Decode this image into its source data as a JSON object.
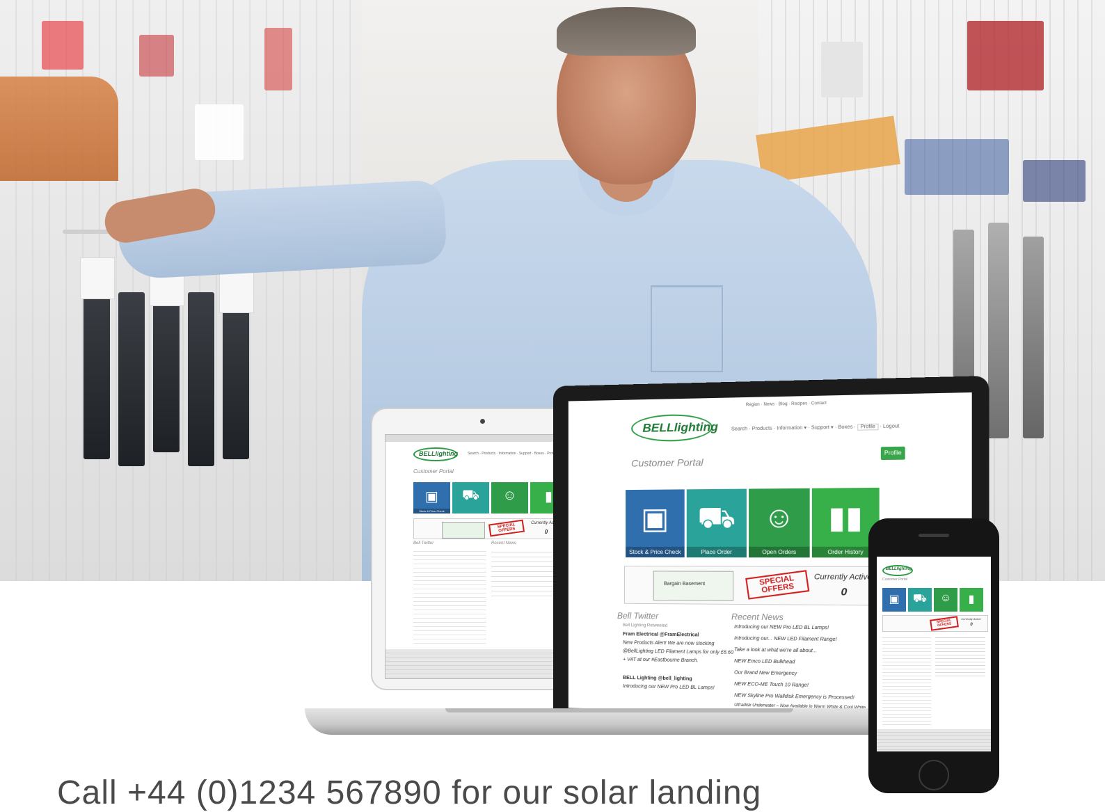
{
  "brand": {
    "logo": "BELLlighting",
    "accent": "#3aa64b"
  },
  "laptop": {
    "top_nav": [
      "Region",
      "News",
      "Blog",
      "Recipes",
      "Contact"
    ],
    "nav": [
      "Search",
      "Products",
      "Information",
      "Support",
      "Boxes",
      "Profile",
      "Logout"
    ],
    "portal_title": "Customer Portal",
    "profile_button": "Profile",
    "tiles": [
      {
        "label": "Stock & Price Check",
        "color": "#2f6fae",
        "icon": "monitor-icon"
      },
      {
        "label": "Place Order",
        "color": "#2aa39a",
        "icon": "cart-icon"
      },
      {
        "label": "Open Orders",
        "color": "#2f9c4a",
        "icon": "reader-icon"
      },
      {
        "label": "Order History",
        "color": "#38b04a",
        "icon": "books-icon"
      }
    ],
    "bargain_label": "Bargain Basement",
    "offer_stamp": "SPECIAL OFFERS",
    "active_label": "Currently Active:",
    "active_count": "0",
    "twitter_title": "Bell Twitter",
    "tweets": [
      "Bell Lighting Retweeted",
      "Fram Electrical @FramElectrical",
      "New Products Alert! We are now stocking",
      "@BellLighting LED Filament Lamps for only £6.60",
      "+ VAT at our #Eastbourne Branch.",
      "BELL Lighting @bell_lighting",
      "Introducing our NEW Pro LED BL Lamps!"
    ],
    "news_title": "Recent News",
    "news": [
      "Introducing our NEW Pro LED BL Lamps!",
      "Introducing our... NEW LED Filament Range!",
      "Take a look at what we're all about...",
      "NEW Emco LED Bulkhead",
      "Our Brand New Emergency",
      "NEW ECO-ME Touch 10 Range!",
      "NEW Skyline Pro Walldisk Emergency is Processed!",
      "Ultradisk Underwater – Now Available in Warm White & Cool White"
    ]
  },
  "tablet": {
    "portal_title": "Customer Portal",
    "tiles": [
      {
        "label": "Stock & Price Check",
        "color": "#2f6fae"
      },
      {
        "label": "",
        "color": "#2aa39a"
      },
      {
        "label": "",
        "color": "#2f9c4a"
      },
      {
        "label": "",
        "color": "#38b04a"
      }
    ],
    "bargain_label": "Bargain Basement",
    "offer_stamp": "SPECIAL OFFERS",
    "active_label": "Currently Active:",
    "active_count": "0",
    "twitter_title": "Bell Twitter",
    "news_title": "Recent News"
  },
  "phone": {
    "portal_title": "Customer Portal",
    "offer_stamp": "SPECIAL OFFERS",
    "active_label": "Currently Active:",
    "active_count": "0"
  },
  "call_to_action": "Call +44 (0)1234 567890 for our solar landing"
}
